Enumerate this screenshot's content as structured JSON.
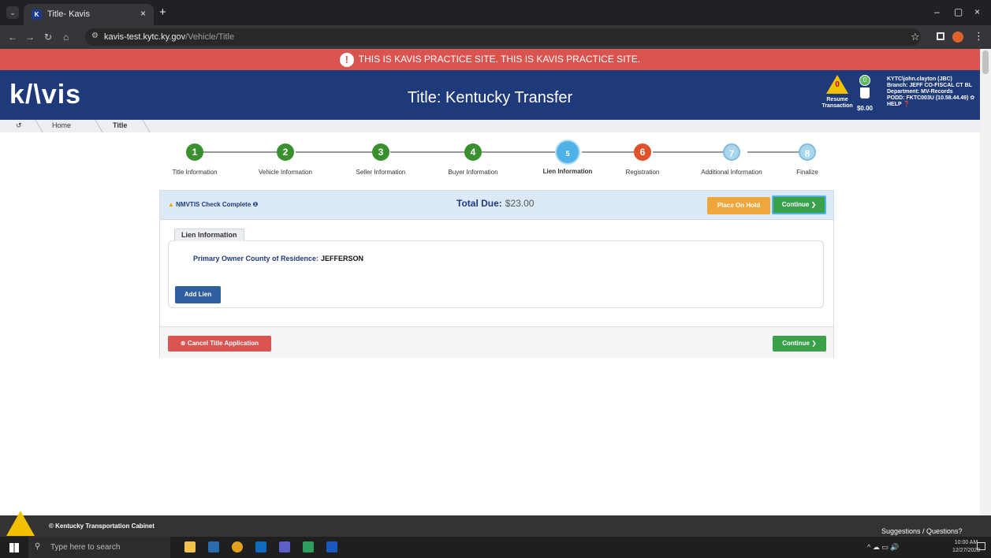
{
  "browser": {
    "tab_title": "Title- Kavis",
    "tab_dropdown": "⌄",
    "tab_close": "×",
    "new_tab": "+",
    "url_domain": "kavis-test.kytc.ky.gov",
    "url_path": "/Vehicle/Title",
    "window_controls": [
      "–",
      "▢",
      "×"
    ]
  },
  "banner": {
    "text": "THIS IS KAVIS PRACTICE SITE. THIS IS KAVIS PRACTICE SITE.",
    "icon": "!"
  },
  "header": {
    "logo": "k/\\vis",
    "title": "Title: Kentucky Transfer",
    "resume_count": "0",
    "resume_label_1": "Resume",
    "resume_label_2": "Transaction",
    "cart_count": "0",
    "cart_total": "$0.00",
    "user": "KYTC\\john.clayton (JBC)",
    "branch": "Branch: JEFF CO-FISCAL CT BL",
    "department": "Department: MV-Records",
    "podd": "PODD: FKTC003U (10.58.44.49) ✿",
    "help": "HELP ❓"
  },
  "breadcrumb": {
    "home_icon": "↺",
    "items": [
      "Home",
      "Title"
    ]
  },
  "steps": [
    {
      "num": "1",
      "label": "Title Information",
      "color": "#3a8f2f"
    },
    {
      "num": "2",
      "label": "Vehicle Information",
      "color": "#3a8f2f"
    },
    {
      "num": "3",
      "label": "Seller Information",
      "color": "#3a8f2f"
    },
    {
      "num": "4",
      "label": "Buyer Information",
      "color": "#3a8f2f"
    },
    {
      "num": "5",
      "label": "Lien Information",
      "color": "#4fb2e8"
    },
    {
      "num": "6",
      "label": "Registration",
      "color": "#e0522b"
    },
    {
      "num": "7",
      "label": "Additional Information",
      "color": "#a9d6ec"
    },
    {
      "num": "8",
      "label": "Finalize",
      "color": "#a9d6ec"
    }
  ],
  "panel": {
    "nmvtis": "NMVTIS Check Complete ❶",
    "nmvtis_warn": "▲",
    "total_label": "Total Due:",
    "total_value": "$23.00",
    "hold_button": "Place On Hold",
    "continue_button": "Continue ❯",
    "section_tab": "Lien Information",
    "county_label": "Primary Owner County of Residence:",
    "county_value": "JEFFERSON",
    "add_lien_button": "Add Lien",
    "cancel_button": "⊗ Cancel Title Application",
    "continue_button_bottom": "Continue ❯"
  },
  "footer": {
    "text": "© Kentucky Transportation Cabinet",
    "help": "Suggestions / Questions?"
  },
  "taskbar": {
    "search_placeholder": "Type here to search",
    "time": "10:00 AM",
    "date": "12/27/2023",
    "tray_icons": "^ ☁ ▭ 🔊"
  }
}
